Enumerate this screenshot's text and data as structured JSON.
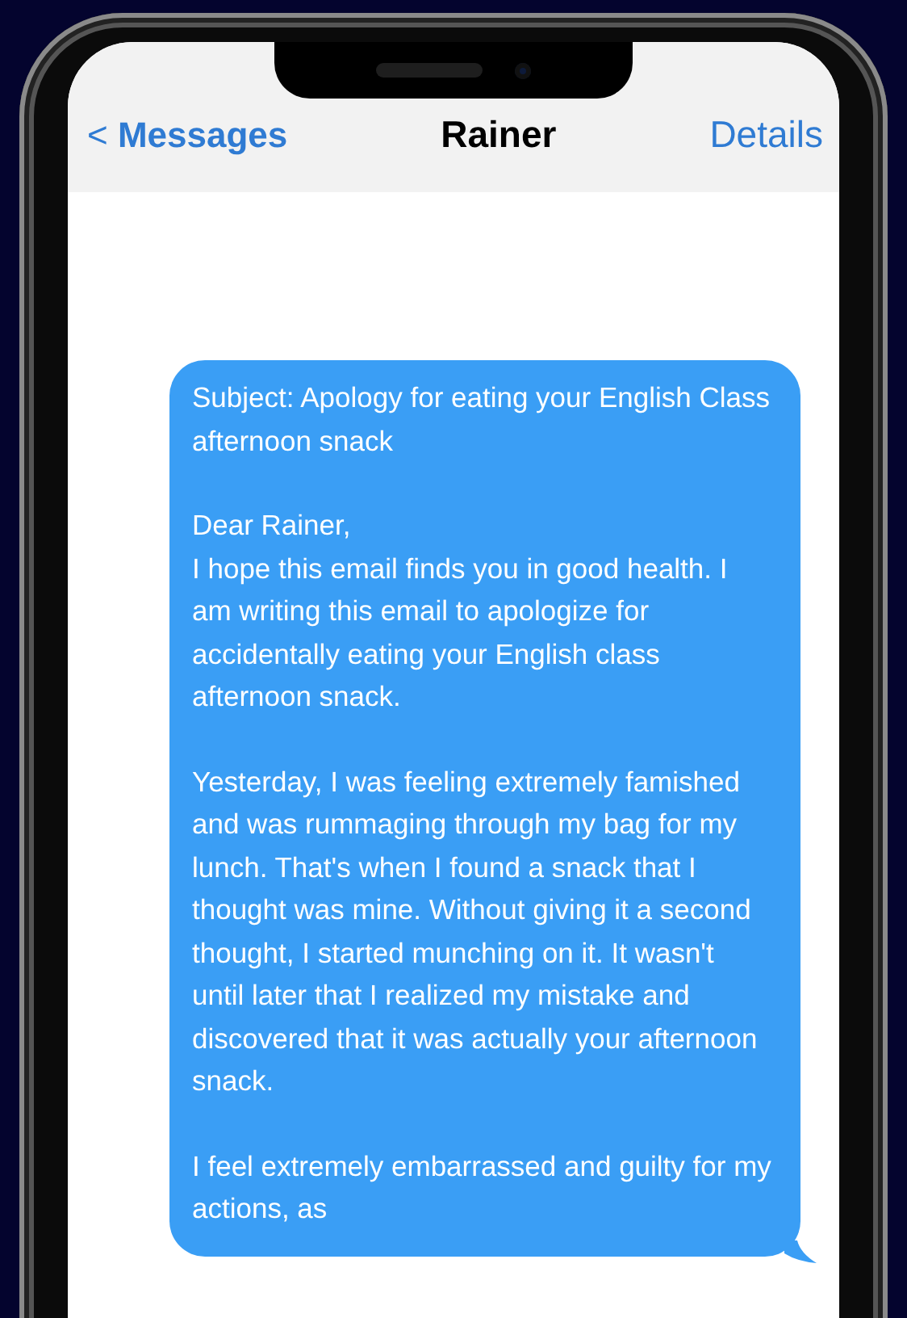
{
  "nav": {
    "back_icon": "<",
    "back": "Messages",
    "title": "Rainer",
    "action": "Details"
  },
  "message": {
    "paragraphs": [
      "Subject: Apology for eating your English Class afternoon snack",
      "Dear Rainer,\nI hope this email finds you in good health. I am writing this email to apologize for accidentally eating your English class afternoon snack.",
      "Yesterday, I was feeling extremely famished and was rummaging through my bag for my lunch. That's when I found a snack that I thought was mine. Without giving it a second thought, I started munching on it. It wasn't until later that I realized my mistake and discovered that it was actually your afternoon snack.",
      "I feel extremely embarrassed and guilty for my actions, as"
    ]
  }
}
